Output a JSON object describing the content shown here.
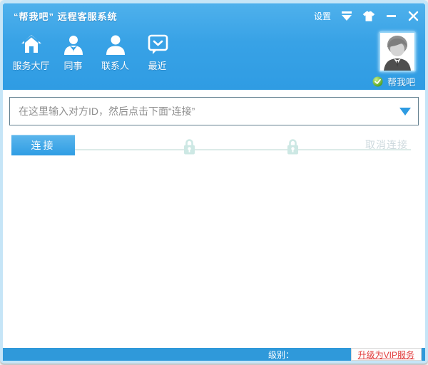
{
  "window": {
    "title": "“帮我吧” 远程客服系统"
  },
  "titlebar": {
    "settings": "设置",
    "icons": [
      "pulldown-icon",
      "skin-shirt-icon",
      "minimize-icon",
      "close-icon"
    ]
  },
  "toolbar": {
    "items": [
      {
        "label": "服务大厅",
        "icon": "home-icon"
      },
      {
        "label": "同事",
        "icon": "colleague-icon"
      },
      {
        "label": "联系人",
        "icon": "contact-icon"
      },
      {
        "label": "最近",
        "icon": "recent-chat-icon"
      }
    ]
  },
  "user": {
    "name": "帮我吧",
    "status_icon": "online-green-badge",
    "avatar": "grayscale-cartoon-avatar"
  },
  "main": {
    "input_placeholder": "在这里输入对方ID，然后点击下面“连接”",
    "input_value": "",
    "connect_label": "连接",
    "cancel_label": "取消连接",
    "lock_icons": 2
  },
  "footer": {
    "level_label": "级别：",
    "vip_link_label": "升级为VIP服务"
  },
  "colors": {
    "header_blue_top": "#4fb1ec",
    "header_blue_bottom": "#2f9ce3",
    "footer_blue": "#2f99da",
    "window_frame": "#c6e5f7",
    "input_border": "#63808f",
    "placeholder_gray": "#8f8f8f",
    "accent_blue": "#2e9be2",
    "lock_teal": "#cde8e4",
    "progress_line": "#dcebe8",
    "cancel_gray": "#ccd8dd",
    "vip_red": "#e23b3b",
    "status_green": "#58b226"
  }
}
